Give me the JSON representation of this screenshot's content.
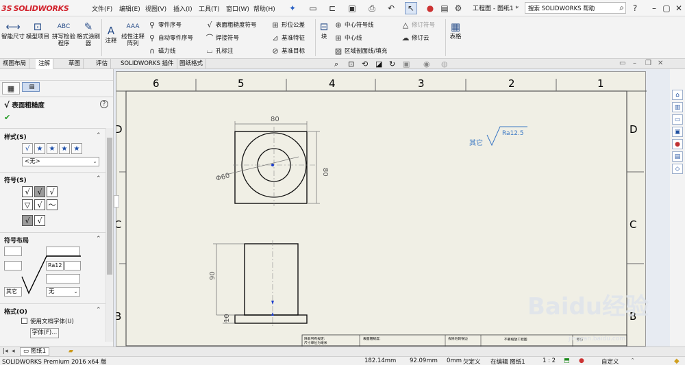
{
  "titlebar": {
    "brand_ds": "3S",
    "brand_name": "SOLIDWORKS",
    "menus": [
      "文件(F)",
      "编辑(E)",
      "视图(V)",
      "插入(I)",
      "工具(T)",
      "窗口(W)",
      "帮助(H)"
    ],
    "doc_title": "工程图 - 图纸1 *",
    "search_placeholder": "搜索 SOLIDWORKS 帮助",
    "help": "?"
  },
  "ribbon": {
    "smart_dim": "智能尺寸",
    "model_items": "模型项目",
    "spell_check": "拼写检验程序",
    "format_painter": "格式涂刷器",
    "note": "注释",
    "linear_note": "线性注释阵列",
    "balloon": "零件序号",
    "auto_balloon": "自动零件序号",
    "magnetic_line": "磁力线",
    "surface_finish": "表面粗糙度符号",
    "weld_symbol": "焊接符号",
    "hole_callout": "孔标注",
    "gtol": "形位公差",
    "datum_feature": "基准特征",
    "datum_target": "基准目标",
    "block": "块",
    "center_mark": "中心符号线",
    "center_line": "中心线",
    "area_hatch": "区域剖面线/填充",
    "revision_symbol": "修订符号",
    "revision_cloud": "修订云",
    "table": "表格"
  },
  "tabs": [
    "视图布局",
    "注解",
    "草图",
    "评估",
    "SOLIDWORKS 插件",
    "图纸格式"
  ],
  "panel": {
    "title": "表面粗糙度",
    "help": "?",
    "style_head": "样式(S)",
    "style_select": "<无>",
    "symbol_head": "符号(S)",
    "layout_head": "符号布局",
    "ra_value": "Ra12",
    "other": "其它",
    "none_select": "无",
    "format_head": "格式(O)",
    "use_doc_font": "使用文档字体(U)",
    "font_button": "字体(F)..."
  },
  "drawing": {
    "zones_top": [
      "6",
      "5",
      "4",
      "3",
      "2",
      "1"
    ],
    "zones_side": [
      "D",
      "C",
      "B"
    ],
    "dim_80_top": "80",
    "dim_80_side": "80",
    "dim_phi60": "Φ60",
    "dim_90": "90",
    "dim_10": "10",
    "finish_label": "其它",
    "finish_value": "Ra12.5",
    "title_block": [
      "除非另有规定:",
      "尺寸单位为毫米",
      "表面粗糙度:",
      "去除毛刺锐边",
      "不要缩放工程图",
      "修订"
    ]
  },
  "sheet_tab": "图纸1",
  "status": {
    "product": "SOLIDWORKS Premium 2016 x64 版",
    "x": "182.14mm",
    "y": "92.09mm",
    "z": "0mm",
    "defined": "欠定义",
    "editing": "在编辑 图纸1",
    "scale": "1 : 2",
    "custom": "自定义"
  },
  "watermark": {
    "text": "Baidu经验",
    "sub": "jingyan.baidu.com"
  }
}
